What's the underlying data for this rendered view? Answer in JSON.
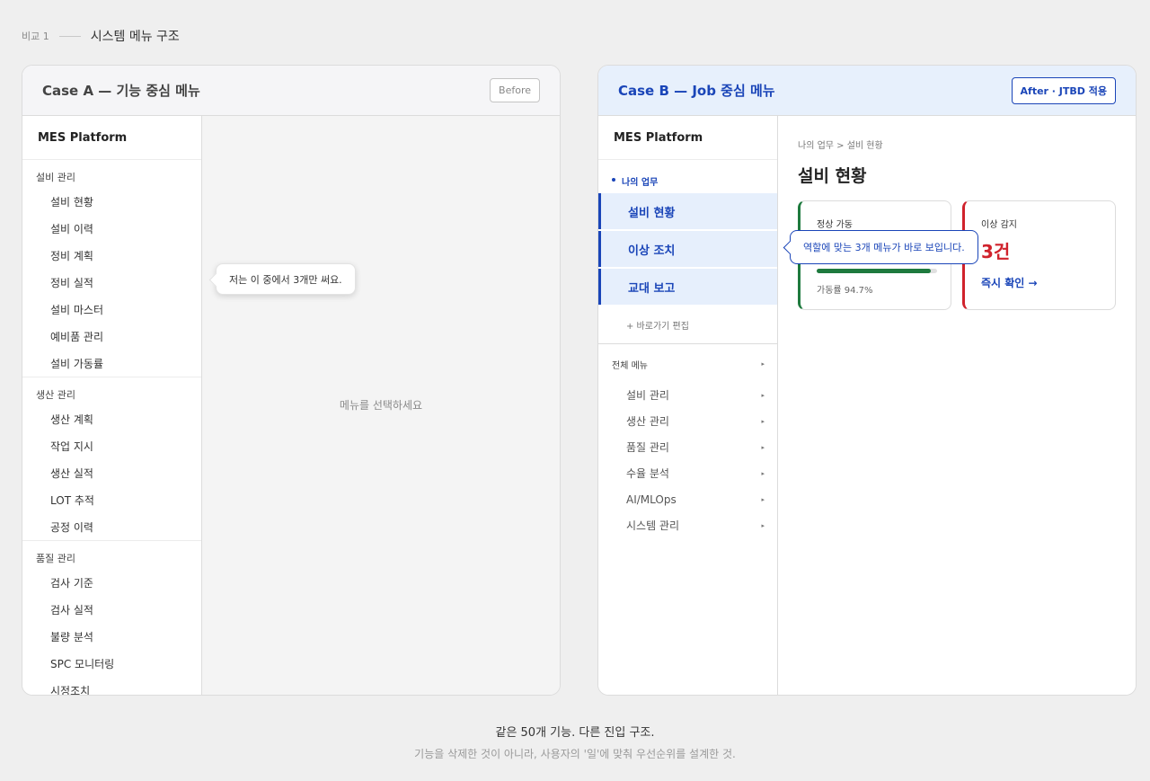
{
  "header": {
    "index": "비교 1",
    "title": "시스템 메뉴 구조"
  },
  "caseA": {
    "title": "Case A — 기능 중심 메뉴",
    "badge": "Before",
    "brand": "MES Platform",
    "groups": [
      {
        "title": "설비 관리",
        "items": [
          "설비 현황",
          "설비 이력",
          "정비 계획",
          "정비 실적",
          "설비 마스터",
          "예비품 관리",
          "설비 가동률"
        ]
      },
      {
        "title": "생산 관리",
        "items": [
          "생산 계획",
          "작업 지시",
          "생산 실적",
          "LOT 추적",
          "공정 이력"
        ]
      },
      {
        "title": "품질 관리",
        "items": [
          "검사 기준",
          "검사 실적",
          "불량 분석",
          "SPC 모니터링",
          "시정조치"
        ]
      }
    ],
    "empty_text": "메뉴를 선택하세요",
    "tooltip": "저는 이 중에서 3개만 써요."
  },
  "caseB": {
    "title": "Case B — Job 중심 메뉴",
    "badge": "After · JTBD 적용",
    "brand": "MES Platform",
    "job_section": "나의 업무",
    "job_items": [
      "설비 현황",
      "이상 조치",
      "교대 보고"
    ],
    "shortcut_edit": "+ 바로가기 편집",
    "all_menu": "전체 메뉴",
    "all_items": [
      "설비 관리",
      "생산 관리",
      "품질 관리",
      "수율 분석",
      "AI/MLOps",
      "시스템 관리"
    ],
    "breadcrumb": "나의 업무 > 설비 현황",
    "page_title": "설비 현황",
    "card_ok": {
      "label": "정상 가동",
      "bar_percent": 94.7,
      "sub": "가동률 94.7%",
      "color": "#1e7a3e"
    },
    "card_alert": {
      "label": "이상 감지",
      "count": "3건",
      "link": "즉시 확인 →",
      "color": "#d0222c"
    },
    "tooltip": "역할에 맞는 3개 메뉴가 바로 보입니다.",
    "caret_icon": "▸"
  },
  "footer": {
    "line1": "같은 50개 기능. 다른 진입 구조.",
    "line2": "기능을 삭제한 것이 아니라, 사용자의 '일'에 맞춰 우선순위를 설계한 것."
  },
  "colors": {
    "accent": "#1a45b8",
    "ok": "#1e7a3e",
    "alert": "#d0222c"
  }
}
